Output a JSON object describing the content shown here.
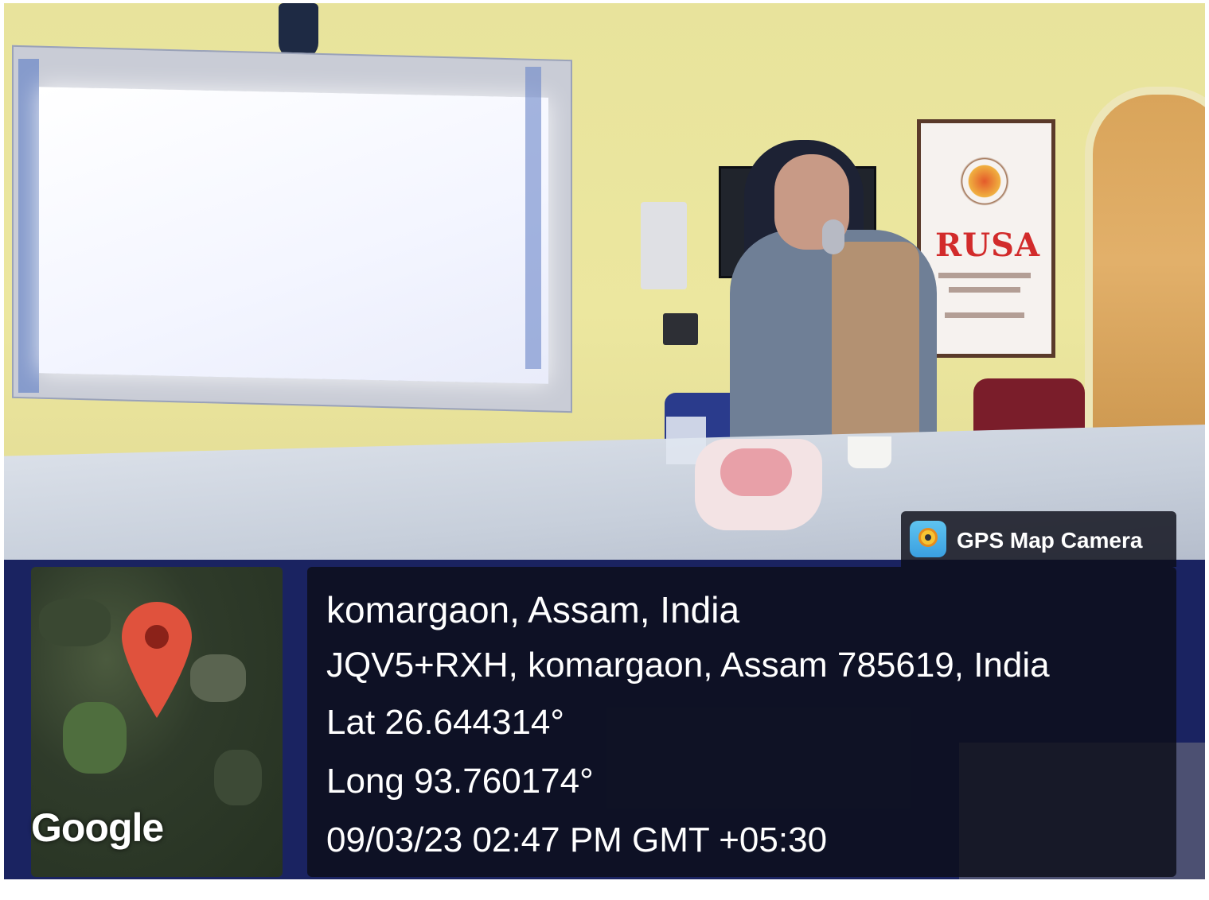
{
  "photo": {
    "wall_sign": "RUSA",
    "icons": [
      "map-pin-icon",
      "camera-app-icon"
    ]
  },
  "overlay": {
    "brand_label": "GPS Map Camera",
    "map_attribution": "Google",
    "location_title": "komargaon, Assam, India",
    "address": "JQV5+RXH, komargaon, Assam 785619, India",
    "latitude": "Lat 26.644314°",
    "longitude": "Long 93.760174°",
    "timestamp": "09/03/23 02:47 PM GMT +05:30",
    "colors": {
      "panel": "#0c0e18",
      "pin": "#e0523d",
      "text": "#ffffff"
    }
  }
}
